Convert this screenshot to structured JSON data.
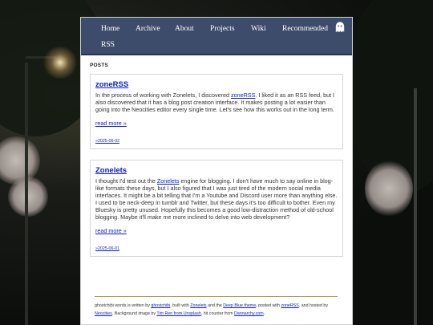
{
  "nav": {
    "items": [
      "Home",
      "Archive",
      "About",
      "Projects",
      "Wiki",
      "Recommended",
      "RSS"
    ],
    "logo_icon": "ghost-icon"
  },
  "section_title": "POSTS",
  "posts": [
    {
      "title": "zoneRSS",
      "body_before_link": "In the process of working with Zonelets, I discovered ",
      "body_link": "zoneRSS",
      "body_after_link": ". I liked it as an RSS feed, but I also discovered that it has a blog post creation interface. It makes posting a lot easier than going into the Neocities editor every single time. Let's see how this works out in the long term.",
      "read_more": "read more »",
      "date": "»2025-06-02"
    },
    {
      "title": "Zonelets",
      "body_before_link": "I thought I'd test out the ",
      "body_link": "Zonelets",
      "body_after_link": " engine for blogging. I don't have much to say online in blog-like formats these days, but I also figured that I was just tired of the modern social media interfaces. It might be a bit telling that I'm a Youtube and Discord user more than anything else. I used to be neck-deep in tumblr and Twitter, but these days it's too difficult to bother. Even my Bluesky is pretty unused. Hopefully this becomes a good low-distraction method of old-school blogging. Maybe it'll make me more inclined to delve into web development?",
      "read_more": "read more »",
      "date": "»2025-06-01"
    }
  ],
  "footer": {
    "t1": "ghostchibi words is written by ",
    "l1": "ghostchibi",
    "t2": ", built with ",
    "l2": "Zonelets",
    "t3": " and the ",
    "l3": "Deep Blue theme",
    "t4": ", posted with ",
    "l4": "zoneRSS",
    "t5": ", and hosted by ",
    "l5": "Neocities",
    "t6": ". Background image by ",
    "l6": "Tim Ren from Unsplash",
    "t7": ", hit counter from ",
    "l7": "Dannarchy.com",
    "t8": "."
  },
  "colors": {
    "nav_bg": "#3e4c6c",
    "link": "#0a1ad8",
    "footer_rule": "#b89a5a"
  }
}
